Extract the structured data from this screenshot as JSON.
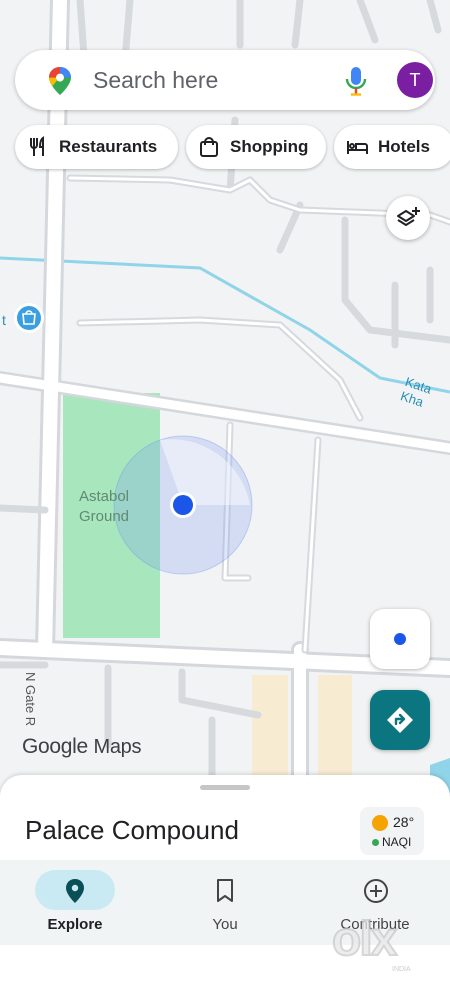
{
  "search": {
    "placeholder": "Search here",
    "avatar_initial": "T"
  },
  "chips": [
    {
      "label": "Restaurants",
      "icon": "fork-knife-icon"
    },
    {
      "label": "Shopping",
      "icon": "shopping-bag-icon"
    },
    {
      "label": "Hotels",
      "icon": "bed-icon"
    }
  ],
  "map": {
    "place_label": "Astabol Ground",
    "road_label": "N Gate R",
    "water_label": "Kata Kha",
    "poi_partial_label": "t",
    "attribution": {
      "google": "Google",
      "maps": "Maps"
    }
  },
  "sheet": {
    "place_title": "Palace Compound",
    "weather": {
      "temperature": "28°",
      "aqi": "NAQI"
    }
  },
  "nav": [
    {
      "label": "Explore",
      "icon": "map-pin-icon",
      "active": true
    },
    {
      "label": "You",
      "icon": "bookmark-icon",
      "active": false
    },
    {
      "label": "Contribute",
      "icon": "add-circle-icon",
      "active": false
    }
  ],
  "watermark": {
    "text": "olx",
    "sub": "INDIA"
  },
  "colors": {
    "accent": "#0b7580",
    "avatar": "#7b1fa2",
    "park": "#a8e6be",
    "water": "#7fd0e6",
    "location_dot": "#1a56e8"
  }
}
